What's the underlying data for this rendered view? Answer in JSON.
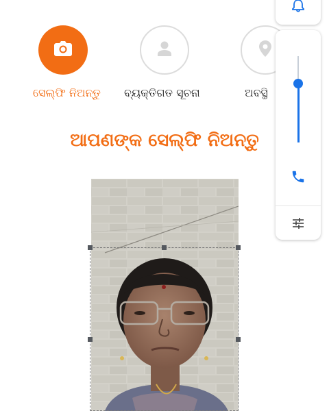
{
  "steps": [
    {
      "label": "ସେଲ୍ଫି ନିଅନ୍ତୁ",
      "icon": "camera-icon",
      "state": "active"
    },
    {
      "label": "ବ୍ୟକ୍ତିଗତ ସୂଚନା",
      "icon": "person-icon",
      "state": "inactive"
    },
    {
      "label": "ଅବସ୍ଥି",
      "icon": "location-pin-icon",
      "state": "inactive"
    }
  ],
  "heading": "ଆପଣଙ୍କ ସେଲ୍ଫି ନିଅନ୍ତୁ",
  "volume_panel": {
    "icons": [
      "bell-icon",
      "phone-icon",
      "settings-sliders-icon"
    ],
    "level": 0.65,
    "accent": "#1a73e8"
  },
  "colors": {
    "brand": "#f26d14",
    "inactive_border": "#dcdcdc"
  }
}
